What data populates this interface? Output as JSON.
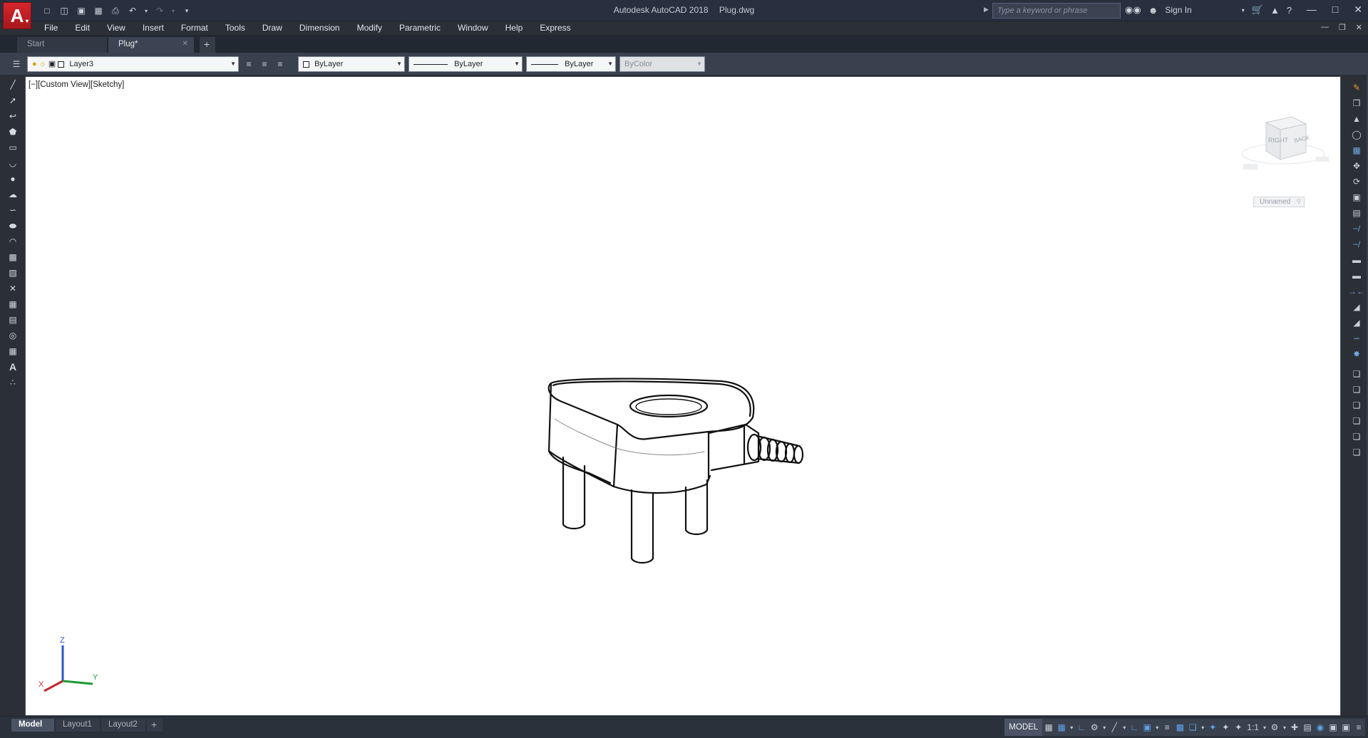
{
  "app": {
    "title": "Autodesk AutoCAD 2018",
    "file": "Plug.dwg",
    "logo_letter": "A",
    "search_placeholder": "Type a keyword or phrase",
    "sign_in": "Sign In"
  },
  "quick_access": [
    "new-icon",
    "open-icon",
    "save-icon",
    "saveas-icon",
    "print-icon",
    "undo-icon",
    "redo-icon",
    "customize-icon"
  ],
  "menu": [
    "File",
    "Edit",
    "View",
    "Insert",
    "Format",
    "Tools",
    "Draw",
    "Dimension",
    "Modify",
    "Parametric",
    "Window",
    "Help",
    "Express"
  ],
  "file_tabs": [
    {
      "label": "Start",
      "active": false
    },
    {
      "label": "Plug*",
      "active": true
    }
  ],
  "add_tab_label": "+",
  "properties": {
    "layer": "Layer3",
    "color": "ByLayer",
    "linetype": "ByLayer",
    "lineweight": "ByLayer",
    "plotstyle": "ByColor"
  },
  "viewport": {
    "label_prefix": "[−]",
    "view": "[Custom View]",
    "style": "[Sketchy]",
    "viewcube_right": "RIGHT",
    "viewcube_back": "BACK",
    "ucs_name": "Unnamed",
    "ucs_z": "Z",
    "ucs_y": "Y",
    "ucs_x": "X"
  },
  "layout_tabs": [
    "Model",
    "Layout1",
    "Layout2"
  ],
  "status": {
    "model": "MODEL",
    "scale": "1:1"
  },
  "colors": {
    "accent": "#d6262c",
    "canvas": "#ffffff",
    "chrome": "#3a414e"
  }
}
